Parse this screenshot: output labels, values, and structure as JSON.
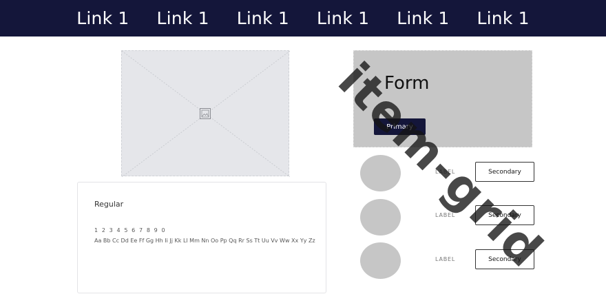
{
  "nav": {
    "links": [
      "Link 1",
      "Link 1",
      "Link 1",
      "Link 1",
      "Link 1",
      "Link 1"
    ]
  },
  "image_placeholder": {
    "icon": "image-icon"
  },
  "form": {
    "title": "Form",
    "primary_label": "Primary"
  },
  "rows": [
    {
      "label": "LABEL",
      "button": "Secondary"
    },
    {
      "label": "LABEL",
      "button": "Secondary"
    },
    {
      "label": "LABEL",
      "button": "Secondary"
    }
  ],
  "typography": {
    "style_name": "Regular",
    "digits": "1 2 3 4 5 6 7 8 9 0",
    "alphabet": "Aa Bb Cc Dd Ee Ff Gg Hh Ii Jj Kk Ll Mm Nn Oo Pp Qq Rr Ss Tt Uu Vv Ww Xx Yy Zz"
  },
  "watermark": "item-grid",
  "colors": {
    "nav_bg": "#14163a",
    "placeholder_bg": "#e5e6ea",
    "panel_gray": "#c6c6c6"
  }
}
